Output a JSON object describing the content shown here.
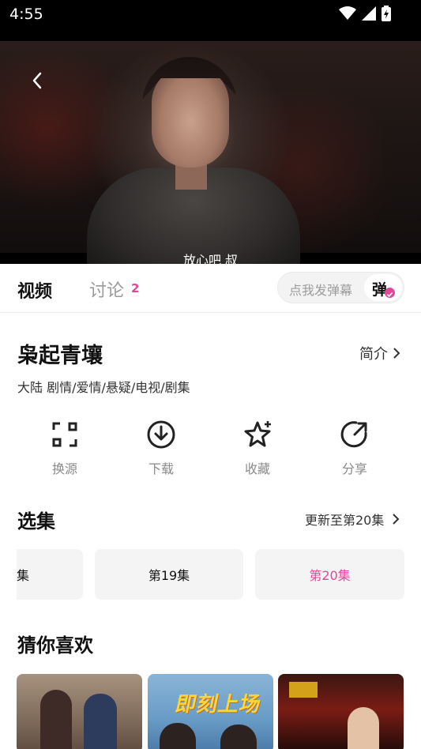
{
  "status_bar": {
    "time": "4:55"
  },
  "player": {
    "subtitle": "放心吧 叔"
  },
  "tabs": {
    "video": "视频",
    "discussion": "讨论",
    "discussion_count": "2"
  },
  "danmu": {
    "placeholder": "点我发弹幕",
    "toggle_label": "弹"
  },
  "show": {
    "title": "枭起青壤",
    "intro_label": "简介",
    "meta": "大陆  剧情/爱情/悬疑/电视/剧集"
  },
  "actions": [
    {
      "label": "换源",
      "icon": "switch-source-icon"
    },
    {
      "label": "下载",
      "icon": "download-icon"
    },
    {
      "label": "收藏",
      "icon": "star-icon"
    },
    {
      "label": "分享",
      "icon": "share-icon"
    }
  ],
  "episodes": {
    "title": "选集",
    "update_text": "更新至第20集",
    "items": [
      {
        "label": "集",
        "selected": false
      },
      {
        "label": "第19集",
        "selected": false
      },
      {
        "label": "第20集",
        "selected": true
      }
    ]
  },
  "recommend": {
    "title": "猜你喜欢",
    "posters": [
      {
        "title": ""
      },
      {
        "title": "即刻上场"
      },
      {
        "title": ""
      }
    ]
  },
  "colors": {
    "accent": "#e0489a",
    "muted": "#8a8a8a"
  }
}
